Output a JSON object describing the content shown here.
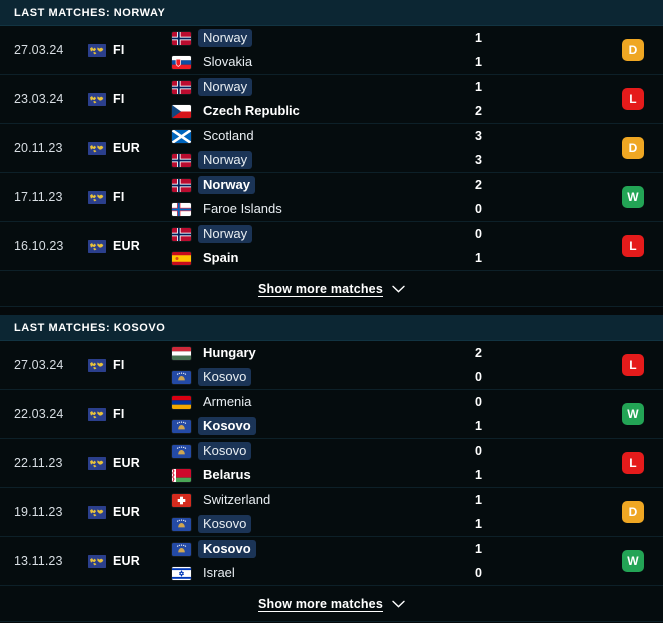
{
  "sections": [
    {
      "id": "norway",
      "header": "LAST MATCHES: NORWAY",
      "show_more_label": "Show more matches",
      "show_more_icon": "chevron-down-icon",
      "matches": [
        {
          "date": "27.03.24",
          "competition": "FI",
          "competition_icon": "world-map-icon",
          "home": {
            "team": "Norway",
            "flag": "no",
            "score": "1",
            "bold": false,
            "highlight": true
          },
          "away": {
            "team": "Slovakia",
            "flag": "sk",
            "score": "1",
            "bold": false,
            "highlight": false
          },
          "result": "D"
        },
        {
          "date": "23.03.24",
          "competition": "FI",
          "competition_icon": "world-map-icon",
          "home": {
            "team": "Norway",
            "flag": "no",
            "score": "1",
            "bold": false,
            "highlight": true
          },
          "away": {
            "team": "Czech Republic",
            "flag": "cz",
            "score": "2",
            "bold": true,
            "highlight": false
          },
          "result": "L"
        },
        {
          "date": "20.11.23",
          "competition": "EUR",
          "competition_icon": "world-map-icon",
          "home": {
            "team": "Scotland",
            "flag": "sco",
            "score": "3",
            "bold": false,
            "highlight": false
          },
          "away": {
            "team": "Norway",
            "flag": "no",
            "score": "3",
            "bold": false,
            "highlight": true
          },
          "result": "D"
        },
        {
          "date": "17.11.23",
          "competition": "FI",
          "competition_icon": "world-map-icon",
          "home": {
            "team": "Norway",
            "flag": "no",
            "score": "2",
            "bold": true,
            "highlight": true
          },
          "away": {
            "team": "Faroe Islands",
            "flag": "fo",
            "score": "0",
            "bold": false,
            "highlight": false
          },
          "result": "W"
        },
        {
          "date": "16.10.23",
          "competition": "EUR",
          "competition_icon": "world-map-icon",
          "home": {
            "team": "Norway",
            "flag": "no",
            "score": "0",
            "bold": false,
            "highlight": true
          },
          "away": {
            "team": "Spain",
            "flag": "es",
            "score": "1",
            "bold": true,
            "highlight": false
          },
          "result": "L"
        }
      ]
    },
    {
      "id": "kosovo",
      "header": "LAST MATCHES: KOSOVO",
      "show_more_label": "Show more matches",
      "show_more_icon": "chevron-down-icon",
      "matches": [
        {
          "date": "27.03.24",
          "competition": "FI",
          "competition_icon": "world-map-icon",
          "home": {
            "team": "Hungary",
            "flag": "hu",
            "score": "2",
            "bold": true,
            "highlight": false
          },
          "away": {
            "team": "Kosovo",
            "flag": "xk",
            "score": "0",
            "bold": false,
            "highlight": true
          },
          "result": "L"
        },
        {
          "date": "22.03.24",
          "competition": "FI",
          "competition_icon": "world-map-icon",
          "home": {
            "team": "Armenia",
            "flag": "am",
            "score": "0",
            "bold": false,
            "highlight": false
          },
          "away": {
            "team": "Kosovo",
            "flag": "xk",
            "score": "1",
            "bold": true,
            "highlight": true
          },
          "result": "W"
        },
        {
          "date": "22.11.23",
          "competition": "EUR",
          "competition_icon": "world-map-icon",
          "home": {
            "team": "Kosovo",
            "flag": "xk",
            "score": "0",
            "bold": false,
            "highlight": true
          },
          "away": {
            "team": "Belarus",
            "flag": "by",
            "score": "1",
            "bold": true,
            "highlight": false
          },
          "result": "L"
        },
        {
          "date": "19.11.23",
          "competition": "EUR",
          "competition_icon": "world-map-icon",
          "home": {
            "team": "Switzerland",
            "flag": "ch",
            "score": "1",
            "bold": false,
            "highlight": false
          },
          "away": {
            "team": "Kosovo",
            "flag": "xk",
            "score": "1",
            "bold": false,
            "highlight": true
          },
          "result": "D"
        },
        {
          "date": "13.11.23",
          "competition": "EUR",
          "competition_icon": "world-map-icon",
          "home": {
            "team": "Kosovo",
            "flag": "xk",
            "score": "1",
            "bold": true,
            "highlight": true
          },
          "away": {
            "team": "Israel",
            "flag": "il",
            "score": "0",
            "bold": false,
            "highlight": false
          },
          "result": "W"
        }
      ]
    }
  ],
  "colors": {
    "win": "#23a455",
    "draw": "#efa723",
    "loss": "#e51b1b",
    "header_bg": "#0c2633",
    "row_bg": "#050c0e",
    "highlight_pill": "#1b3456"
  }
}
